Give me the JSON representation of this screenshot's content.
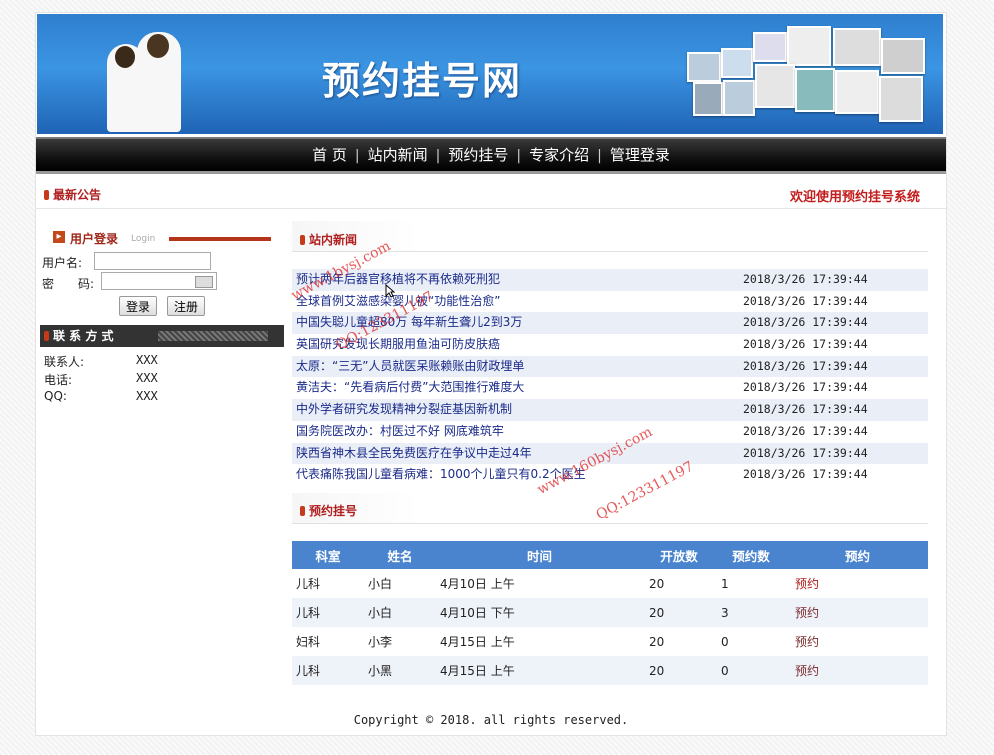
{
  "site": {
    "title": "预约挂号网"
  },
  "nav": {
    "items": [
      "首 页",
      "站内新闻",
      "预约挂号",
      "专家介绍",
      "管理登录"
    ]
  },
  "notice": {
    "heading": "最新公告",
    "welcome": "欢迎使用预约挂号系统"
  },
  "login": {
    "heading": "用户登录",
    "heading_en": "Login",
    "username_label": "用户名:",
    "password_label": "密　　码:",
    "login_button": "登录",
    "register_button": "注册"
  },
  "contact": {
    "heading": "联 系 方 式",
    "rows": [
      {
        "label": "联系人:",
        "value": "XXX"
      },
      {
        "label": "电话:",
        "value": "XXX"
      },
      {
        "label": "QQ:",
        "value": "XXX"
      }
    ]
  },
  "news": {
    "heading": "站内新闻",
    "items": [
      {
        "title": "预计两年后器官移植将不再依赖死刑犯",
        "time": "2018/3/26 17:39:44"
      },
      {
        "title": "全球首例艾滋感染婴儿被“功能性治愈”",
        "time": "2018/3/26 17:39:44"
      },
      {
        "title": "中国失聪儿童超80万 每年新生聋儿2到3万",
        "time": "2018/3/26 17:39:44"
      },
      {
        "title": "英国研究发现长期服用鱼油可防皮肤癌",
        "time": "2018/3/26 17:39:44"
      },
      {
        "title": "太原：“三无”人员就医呆账赖账由财政埋单",
        "time": "2018/3/26 17:39:44"
      },
      {
        "title": "黄洁夫：“先看病后付费”大范围推行难度大",
        "time": "2018/3/26 17:39:44"
      },
      {
        "title": "中外学者研究发现精神分裂症基因新机制",
        "time": "2018/3/26 17:39:44"
      },
      {
        "title": "国务院医改办：村医过不好 网底难筑牢",
        "time": "2018/3/26 17:39:44"
      },
      {
        "title": "陕西省神木县全民免费医疗在争议中走过4年",
        "time": "2018/3/26 17:39:44"
      },
      {
        "title": "代表痛陈我国儿童看病难：1000个儿童只有0.2个医生",
        "time": "2018/3/26 17:39:44"
      }
    ]
  },
  "appointments": {
    "heading": "预约挂号",
    "columns": [
      "科室",
      "姓名",
      "时间",
      "开放数",
      "预约数",
      "预约"
    ],
    "rows": [
      {
        "dept": "儿科",
        "name": "小白",
        "time": "4月10日 上午",
        "open": "20",
        "booked": "1",
        "action": "预约"
      },
      {
        "dept": "儿科",
        "name": "小白",
        "time": "4月10日 下午",
        "open": "20",
        "booked": "3",
        "action": "预约"
      },
      {
        "dept": "妇科",
        "name": "小李",
        "time": "4月15日 上午",
        "open": "20",
        "booked": "0",
        "action": "预约"
      },
      {
        "dept": "儿科",
        "name": "小黑",
        "time": "4月15日 上午",
        "open": "20",
        "booked": "0",
        "action": "预约"
      }
    ]
  },
  "footer": {
    "text": "Copyright © 2018. all rights reserved."
  },
  "watermarks": [
    "www.1bysj.com",
    "QQ:123311197",
    "www.160bysj.com",
    "QQ:123311197"
  ]
}
